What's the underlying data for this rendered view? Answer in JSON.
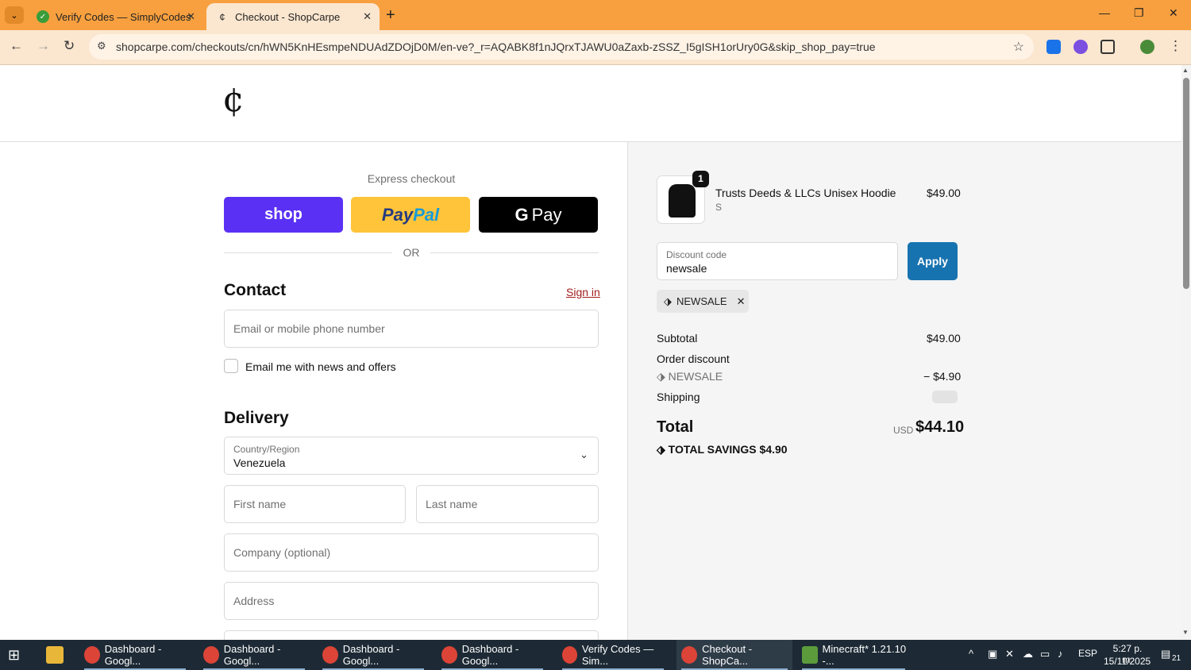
{
  "browser": {
    "tabs": [
      {
        "title": "Verify Codes — SimplyCodes",
        "active": false
      },
      {
        "title": "Checkout - ShopCarpe",
        "active": true
      }
    ],
    "url": "shopcarpe.com/checkouts/cn/hWN5KnHEsmpeNDUAdZDOjD0M/en-ve?_r=AQABK8f1nJQrxTJAWU0aZaxb-zSSZ_I5gISH1orUry0G&skip_shop_pay=true",
    "colors": {
      "tabbar": "#f8a03f",
      "toolbar": "#fbe6cf"
    }
  },
  "checkout": {
    "express_label": "Express checkout",
    "shop_label": "shop",
    "paypal_label_1": "Pay",
    "paypal_label_2": "Pal",
    "gpay_label": "Pay",
    "or_label": "OR",
    "contact_heading": "Contact",
    "sign_in": "Sign in",
    "email_placeholder": "Email or mobile phone number",
    "newsletter_label": "Email me with news and offers",
    "delivery_heading": "Delivery",
    "country_label": "Country/Region",
    "country_value": "Venezuela",
    "first_name_placeholder": "First name",
    "last_name_placeholder": "Last name",
    "company_placeholder": "Company (optional)",
    "address_placeholder": "Address"
  },
  "summary": {
    "item_qty": "1",
    "item_name": "Trusts Deeds & LLCs Unisex Hoodie",
    "item_variant": "S",
    "item_price": "$49.00",
    "discount_label": "Discount code",
    "discount_value": "newsale",
    "apply_label": "Apply",
    "applied_code": "NEWSALE",
    "subtotal_label": "Subtotal",
    "subtotal_value": "$49.00",
    "order_discount_label": "Order discount",
    "discount_code_line": "NEWSALE",
    "discount_amount": "− $4.90",
    "shipping_label": "Shipping",
    "total_label": "Total",
    "currency": "USD",
    "total_value": "$44.10",
    "savings_label": "TOTAL SAVINGS",
    "savings_value": "$4.90",
    "accent_color": "#1773b0"
  },
  "taskbar": {
    "items": [
      "Dashboard - Googl...",
      "Dashboard - Googl...",
      "Dashboard - Googl...",
      "Dashboard - Googl...",
      "Verify Codes — Sim...",
      "Checkout - ShopCa...",
      "Minecraft* 1.21.10 -..."
    ],
    "language": "ESP",
    "time": "5:27 p. m.",
    "date": "15/11/2025",
    "notifications": "21"
  }
}
